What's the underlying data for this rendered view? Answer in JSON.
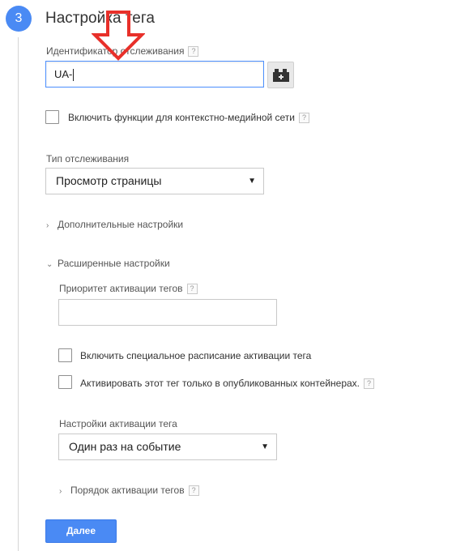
{
  "step": {
    "number": "3",
    "title": "Настройка тега"
  },
  "tracking_id": {
    "label": "Идентификатор отслеживания",
    "value": "UA-",
    "help": "?"
  },
  "display_features": {
    "label": "Включить функции для контекстно-медийной сети",
    "help": "?",
    "checked": false
  },
  "tracking_type": {
    "label": "Тип отслеживания",
    "selected": "Просмотр страницы",
    "arrow": "▼"
  },
  "more_settings": {
    "label": "Дополнительные настройки",
    "chevron": "›"
  },
  "advanced_settings": {
    "label": "Расширенные настройки",
    "chevron": "⌄",
    "priority": {
      "label": "Приоритет активации тегов",
      "help": "?",
      "value": ""
    },
    "schedule": {
      "label": "Включить специальное расписание активации тега",
      "checked": false
    },
    "published_only": {
      "label": "Активировать этот тег только в опубликованных контейнерах.",
      "help": "?",
      "checked": false
    },
    "firing_options": {
      "label": "Настройки активации тега",
      "selected": "Один раз на событие",
      "arrow": "▼"
    },
    "sequencing": {
      "label": "Порядок активации тегов",
      "help": "?",
      "chevron": "›"
    }
  },
  "continue_button": {
    "label": "Далее"
  },
  "colors": {
    "accent": "#4a8af4",
    "annotation_arrow": "#e8302a"
  },
  "icons": {
    "variable_picker": "lego-brick-plus-icon",
    "annotation": "red-down-arrow-icon"
  }
}
